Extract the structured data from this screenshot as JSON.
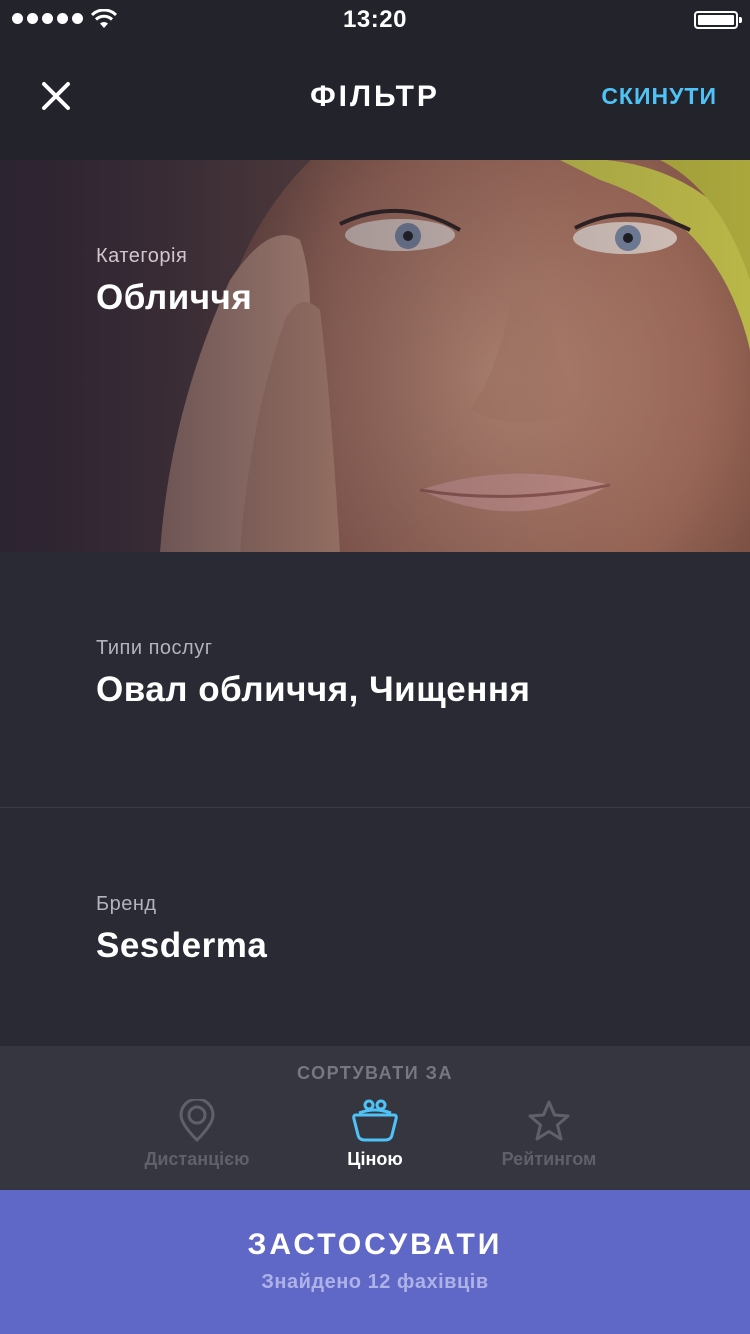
{
  "status_bar": {
    "time": "13:20"
  },
  "nav": {
    "title": "ФІЛЬТР",
    "reset_label": "СКИНУТИ"
  },
  "filters": {
    "category": {
      "label": "Категорія",
      "value": "Обличчя"
    },
    "services": {
      "label": "Типи послуг",
      "value": "Овал обличчя, Чищення"
    },
    "brand": {
      "label": "Бренд",
      "value": "Sesderma"
    }
  },
  "sort": {
    "title": "СОРТУВАТИ ЗА",
    "options": [
      {
        "label": "Дистанцією",
        "icon": "map-pin-icon",
        "active": false
      },
      {
        "label": "Ціною",
        "icon": "purse-icon",
        "active": true
      },
      {
        "label": "Рейтингом",
        "icon": "star-icon",
        "active": false
      }
    ]
  },
  "apply": {
    "label": "ЗАСТОСУВАТИ",
    "count_text": "Знайдено 12 фахівців"
  },
  "colors": {
    "background": "#292a34",
    "header": "#22232b",
    "accent_link": "#4fc3f7",
    "apply_button": "#5f67c7",
    "sort_bar": "#35363f"
  }
}
